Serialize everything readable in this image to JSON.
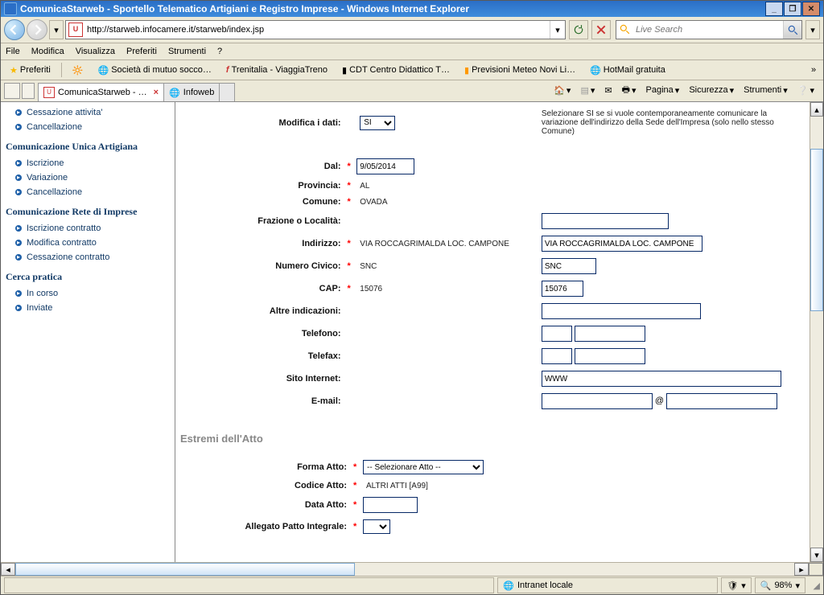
{
  "window_title": "ComunicaStarweb - Sportello Telematico Artigiani e Registro Imprese - Windows Internet Explorer",
  "address_url": "http://starweb.infocamere.it/starweb/index.jsp",
  "search_placeholder": "Live Search",
  "menubar": {
    "file": "File",
    "modifica": "Modifica",
    "visualizza": "Visualizza",
    "preferiti": "Preferiti",
    "strumenti": "Strumenti",
    "help": "?"
  },
  "favbar": {
    "preferiti": "Preferiti",
    "items": [
      "Società di mutuo socco…",
      "Trenitalia - ViaggiaTreno",
      "CDT   Centro Didattico T…",
      "Previsioni Meteo Novi Li…",
      "HotMail gratuita"
    ]
  },
  "tabs": {
    "active": "ComunicaStarweb - …",
    "inactive": "Infoweb"
  },
  "commandbar": {
    "pagina": "Pagina",
    "sicurezza": "Sicurezza",
    "strumenti": "Strumenti"
  },
  "sidebar": {
    "top_items": [
      "Cessazione attivita'",
      "Cancellazione"
    ],
    "section_cua": "Comunicazione Unica Artigiana",
    "cua_items": [
      "Iscrizione",
      "Variazione",
      "Cancellazione"
    ],
    "section_rete": "Comunicazione Rete di Imprese",
    "rete_items": [
      "Iscrizione contratto",
      "Modifica contratto",
      "Cessazione contratto"
    ],
    "section_cerca": "Cerca pratica",
    "cerca_items": [
      "In corso",
      "Inviate"
    ]
  },
  "form": {
    "modifica_dati_label": "Modifica i dati:",
    "modifica_dati_value": "SI",
    "modifica_dati_hint": "Selezionare SI se si vuole contemporaneamente comunicare la variazione dell'indirizzo della Sede dell'Impresa (solo nello stesso Comune)",
    "dal_label": "Dal:",
    "dal_value": "9/05/2014",
    "provincia_label": "Provincia:",
    "provincia_value": "AL",
    "comune_label": "Comune:",
    "comune_value": "OVADA",
    "frazione_label": "Frazione o Località:",
    "indirizzo_label": "Indirizzo:",
    "indirizzo_ro": "VIA ROCCAGRIMALDA LOC. CAMPONE",
    "indirizzo_value": "VIA ROCCAGRIMALDA LOC. CAMPONE",
    "civico_label": "Numero Civico:",
    "civico_ro": "SNC",
    "civico_value": "SNC",
    "cap_label": "CAP:",
    "cap_ro": "15076",
    "cap_value": "15076",
    "altre_label": "Altre indicazioni:",
    "telefono_label": "Telefono:",
    "telefax_label": "Telefax:",
    "sito_label": "Sito Internet:",
    "sito_value": "WWW",
    "email_label": "E-mail:",
    "email_at": "@",
    "section_atto": "Estremi dell'Atto",
    "forma_atto_label": "Forma Atto:",
    "forma_atto_value": "-- Selezionare Atto --",
    "codice_atto_label": "Codice Atto:",
    "codice_atto_value": "ALTRI ATTI [A99]",
    "data_atto_label": "Data Atto:",
    "allegato_label": "Allegato Patto Integrale:"
  },
  "status": {
    "zone": "Intranet locale",
    "zoom": "98%"
  }
}
